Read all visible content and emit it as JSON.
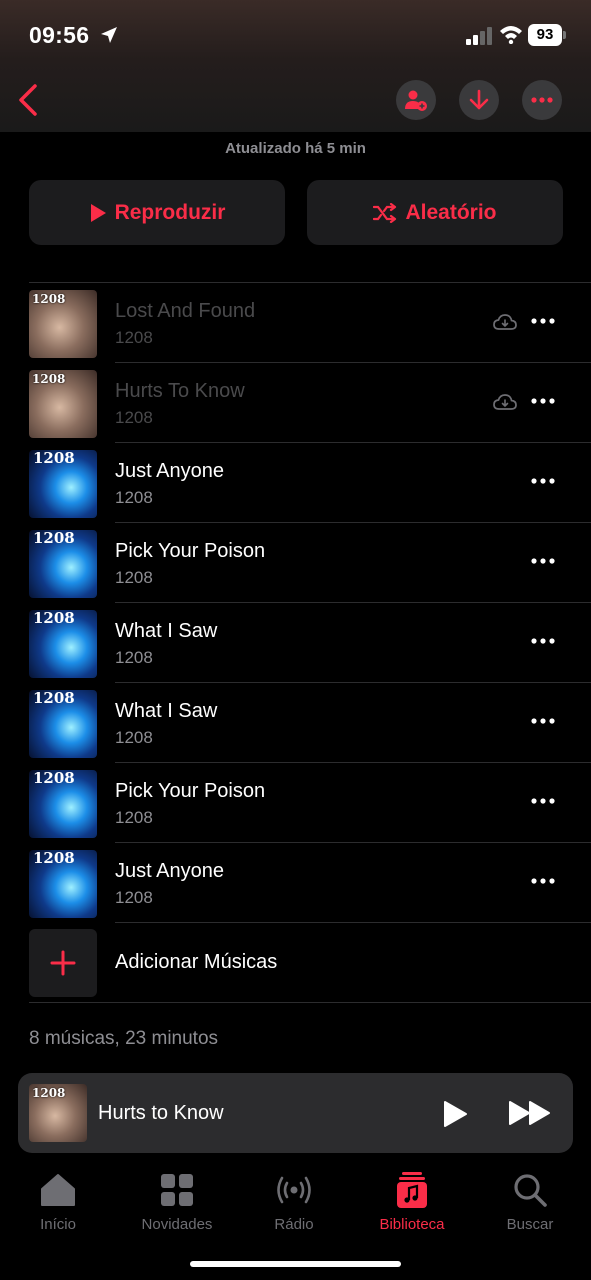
{
  "status_bar": {
    "time": "09:56",
    "battery": "93"
  },
  "header": {
    "updated_text": "Atualizado há 5 min"
  },
  "actions": {
    "play_label": "Reproduzir",
    "shuffle_label": "Aleatório"
  },
  "tracks": [
    {
      "title": "Lost And Found",
      "artist": "1208",
      "art_text": "1208",
      "cloud": true
    },
    {
      "title": "Hurts To Know",
      "artist": "1208",
      "art_text": "1208",
      "cloud": true
    },
    {
      "title": "Just Anyone",
      "artist": "1208",
      "art_text": "1208",
      "cloud": false
    },
    {
      "title": "Pick Your Poison",
      "artist": "1208",
      "art_text": "1208",
      "cloud": false
    },
    {
      "title": "What I Saw",
      "artist": "1208",
      "art_text": "1208",
      "cloud": false
    },
    {
      "title": "What I Saw",
      "artist": "1208",
      "art_text": "1208",
      "cloud": false
    },
    {
      "title": "Pick Your Poison",
      "artist": "1208",
      "art_text": "1208",
      "cloud": false
    },
    {
      "title": "Just Anyone",
      "artist": "1208",
      "art_text": "1208",
      "cloud": false
    }
  ],
  "add_songs_label": "Adicionar Músicas",
  "summary": "8 músicas, 23 minutos",
  "mini_player": {
    "title": "Hurts to Know",
    "art_text": "1208"
  },
  "tabs": [
    {
      "label": "Início",
      "icon": "house-icon",
      "active": false
    },
    {
      "label": "Novidades",
      "icon": "grid-icon",
      "active": false
    },
    {
      "label": "Rádio",
      "icon": "radio-icon",
      "active": false
    },
    {
      "label": "Biblioteca",
      "icon": "library-icon",
      "active": true
    },
    {
      "label": "Buscar",
      "icon": "search-icon",
      "active": false
    }
  ],
  "colors": {
    "accent": "#fa2d48",
    "background": "#000000",
    "secondary_text": "#8e8e93"
  }
}
